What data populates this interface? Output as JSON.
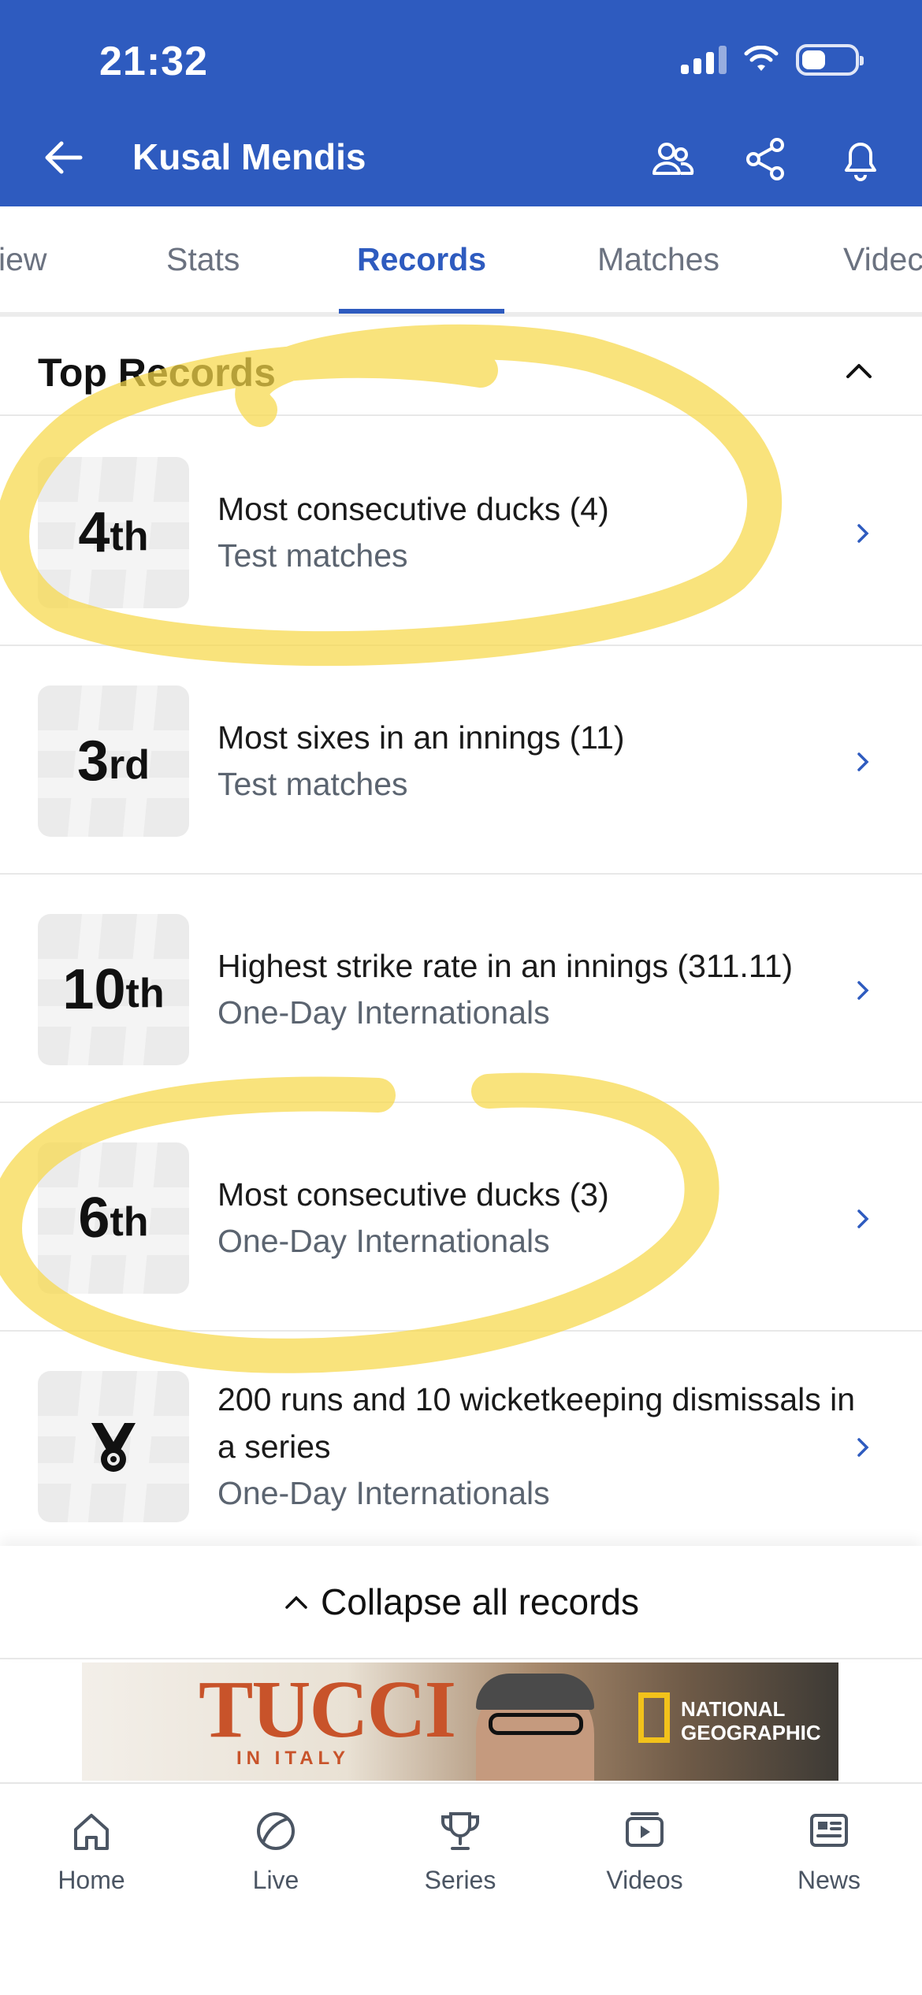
{
  "status_bar": {
    "time": "21:32"
  },
  "header": {
    "title": "Kusal Mendis"
  },
  "tabs": [
    {
      "label": "iew"
    },
    {
      "label": "Stats"
    },
    {
      "label": "Records"
    },
    {
      "label": "Matches"
    },
    {
      "label": "Videc"
    }
  ],
  "section": {
    "title": "Top Records"
  },
  "records": [
    {
      "rank_num": "4",
      "rank_suffix": "th",
      "title": "Most consecutive ducks (4)",
      "subtitle": "Test matches"
    },
    {
      "rank_num": "3",
      "rank_suffix": "rd",
      "title": "Most sixes in an innings (11)",
      "subtitle": "Test matches"
    },
    {
      "rank_num": "10",
      "rank_suffix": "th",
      "title": "Highest strike rate in an innings (311.11)",
      "subtitle": "One-Day Internationals"
    },
    {
      "rank_num": "6",
      "rank_suffix": "th",
      "title": "Most consecutive ducks (3)",
      "subtitle": "One-Day Internationals"
    },
    {
      "icon": "medal-icon",
      "title": "200 runs and 10 wicketkeeping dismissals in a series",
      "subtitle": "One-Day Internationals"
    }
  ],
  "collapse": {
    "label": "Collapse all records"
  },
  "ad": {
    "title": "TUCCI",
    "subtitle": "IN ITALY",
    "brand_line1": "NATIONAL",
    "brand_line2": "GEOGRAPHIC"
  },
  "bottom_nav": [
    {
      "label": "Home",
      "icon": "home-icon"
    },
    {
      "label": "Live",
      "icon": "ball-icon"
    },
    {
      "label": "Series",
      "icon": "trophy-icon"
    },
    {
      "label": "Videos",
      "icon": "video-icon"
    },
    {
      "label": "News",
      "icon": "news-icon"
    }
  ],
  "colors": {
    "brand": "#2e5bbf",
    "highlight": "#f7d84a"
  }
}
